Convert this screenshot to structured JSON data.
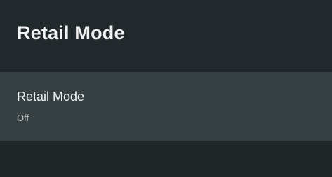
{
  "header": {
    "title": "Retail Mode"
  },
  "settings": {
    "items": [
      {
        "label": "Retail Mode",
        "value": "Off"
      }
    ]
  },
  "colors": {
    "background": "#1f2528",
    "header_background": "#22292c",
    "selected_item_background": "#363f41",
    "primary_text": "#eef1f1",
    "secondary_text": "#b8c0c2"
  }
}
